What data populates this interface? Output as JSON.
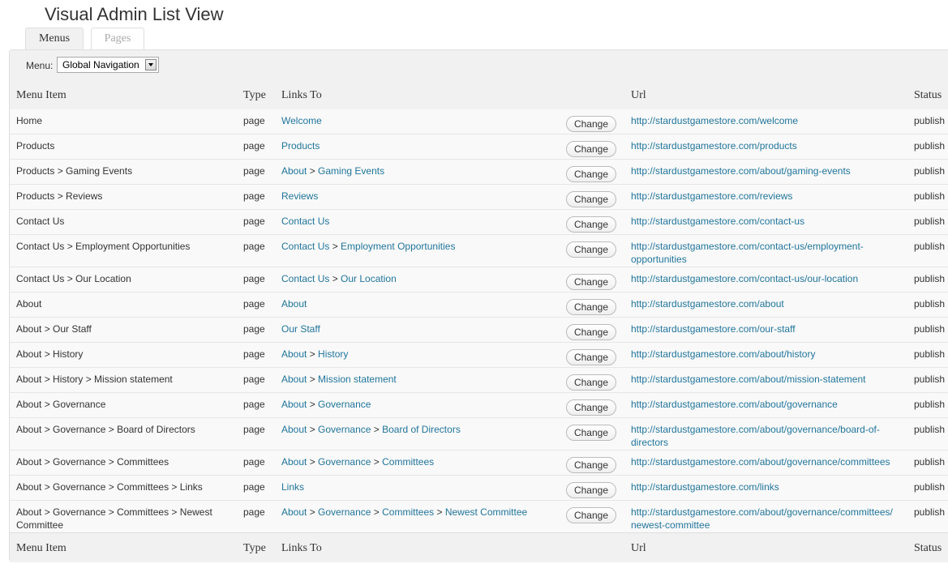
{
  "page_title": "Visual Admin List View",
  "tabs": [
    {
      "label": "Menus",
      "active": true
    },
    {
      "label": "Pages",
      "active": false
    }
  ],
  "toolbar": {
    "menu_label": "Menu:",
    "menu_selected": "Global Navigation"
  },
  "table": {
    "columns": [
      "Menu Item",
      "Type",
      "Links To",
      "Url",
      "Status"
    ],
    "change_label": "Change",
    "rows": [
      {
        "item": "Home",
        "type": "page",
        "links": [
          "Welcome"
        ],
        "url": [
          "http://stardustgamestore.com/welcome"
        ],
        "status": "publish"
      },
      {
        "item": "Products",
        "type": "page",
        "links": [
          "Products"
        ],
        "url": [
          "http://stardustgamestore.com/products"
        ],
        "status": "publish"
      },
      {
        "item": "Products > Gaming Events",
        "type": "page",
        "links": [
          "About",
          "Gaming Events"
        ],
        "url": [
          "http://stardustgamestore.com/about/gaming-events"
        ],
        "status": "publish"
      },
      {
        "item": "Products > Reviews",
        "type": "page",
        "links": [
          "Reviews"
        ],
        "url": [
          "http://stardustgamestore.com/reviews"
        ],
        "status": "publish"
      },
      {
        "item": "Contact Us",
        "type": "page",
        "links": [
          "Contact Us"
        ],
        "url": [
          "http://stardustgamestore.com/contact-us"
        ],
        "status": "publish"
      },
      {
        "item": "Contact Us > Employment Opportunities",
        "type": "page",
        "links": [
          "Contact Us",
          "Employment Opportunities"
        ],
        "url": [
          "http://stardustgamestore.com/contact-us/employment-",
          "opportunities"
        ],
        "status": "publish"
      },
      {
        "item": "Contact Us > Our Location",
        "type": "page",
        "links": [
          "Contact Us",
          "Our Location"
        ],
        "url": [
          "http://stardustgamestore.com/contact-us/our-location"
        ],
        "status": "publish"
      },
      {
        "item": "About",
        "type": "page",
        "links": [
          "About"
        ],
        "url": [
          "http://stardustgamestore.com/about"
        ],
        "status": "publish"
      },
      {
        "item": "About > Our Staff",
        "type": "page",
        "links": [
          "Our Staff"
        ],
        "url": [
          "http://stardustgamestore.com/our-staff"
        ],
        "status": "publish"
      },
      {
        "item": "About > History",
        "type": "page",
        "links": [
          "About",
          "History"
        ],
        "url": [
          "http://stardustgamestore.com/about/history"
        ],
        "status": "publish"
      },
      {
        "item": "About > History > Mission statement",
        "type": "page",
        "links": [
          "About",
          "Mission statement"
        ],
        "url": [
          "http://stardustgamestore.com/about/mission-statement"
        ],
        "status": "publish"
      },
      {
        "item": "About > Governance",
        "type": "page",
        "links": [
          "About",
          "Governance"
        ],
        "url": [
          "http://stardustgamestore.com/about/governance"
        ],
        "status": "publish"
      },
      {
        "item": "About > Governance > Board of Directors",
        "type": "page",
        "links": [
          "About",
          "Governance",
          "Board of Directors"
        ],
        "url": [
          "http://stardustgamestore.com/about/governance/board-of-",
          "directors"
        ],
        "status": "publish"
      },
      {
        "item": "About > Governance > Committees",
        "type": "page",
        "links": [
          "About",
          "Governance",
          "Committees"
        ],
        "url": [
          "http://stardustgamestore.com/about/governance/committees"
        ],
        "status": "publish"
      },
      {
        "item": "About > Governance > Committees > Links",
        "type": "page",
        "links": [
          "Links"
        ],
        "url": [
          "http://stardustgamestore.com/links"
        ],
        "status": "publish"
      },
      {
        "item": "About > Governance > Committees > Newest Committee",
        "type": "page",
        "links": [
          "About",
          "Governance",
          "Committees",
          "Newest Committee"
        ],
        "url": [
          "http://stardustgamestore.com/about/governance/committees/",
          "newest-committee"
        ],
        "status": "publish"
      }
    ]
  },
  "colors": {
    "link": "#21759b",
    "text": "#333333",
    "header_bg": "#f1f1f1",
    "row_bg": "#f9f9f9",
    "border": "#dfdfdf"
  }
}
